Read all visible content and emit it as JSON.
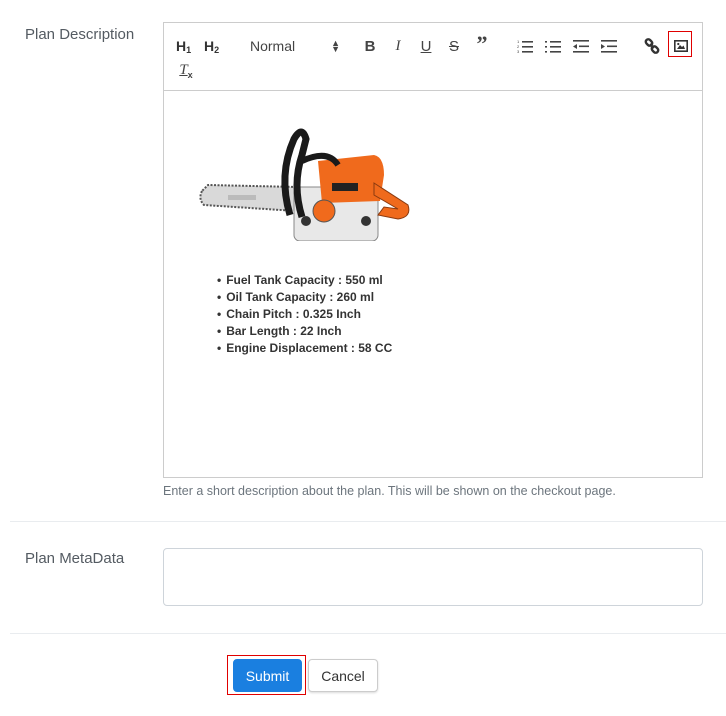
{
  "form": {
    "description_label": "Plan Description",
    "metadata_label": "Plan MetaData",
    "description_help": "Enter a short description about the plan. This will be shown on the checkout page.",
    "metadata_value": ""
  },
  "toolbar": {
    "h1": "H1",
    "h2": "H2",
    "format_select": "Normal",
    "buttons": [
      "bold",
      "italic",
      "underline",
      "strikethrough",
      "blockquote",
      "ordered-list",
      "bullet-list",
      "outdent",
      "indent",
      "link",
      "image",
      "clear-format"
    ],
    "highlighted": "image"
  },
  "editor_content": {
    "image_alt": "Orange chainsaw",
    "specs": [
      "Fuel Tank Capacity : 550 ml",
      "Oil Tank Capacity : 260 ml",
      "Chain Pitch : 0.325 Inch",
      "Bar Length : 22 Inch",
      "Engine Displacement : 58 CC"
    ]
  },
  "actions": {
    "submit_label": "Submit",
    "cancel_label": "Cancel",
    "highlighted": "submit"
  },
  "colors": {
    "primary": "#1a7fe0",
    "highlight": "#e00000"
  }
}
